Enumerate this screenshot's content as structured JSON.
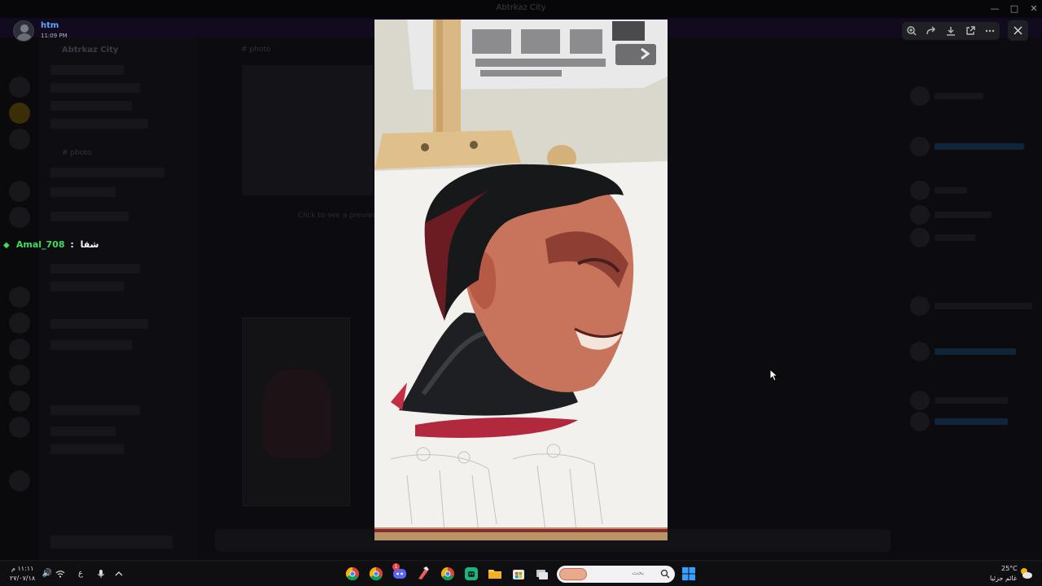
{
  "window": {
    "title": "Abtrkaz City"
  },
  "background_discord": {
    "server_name": "Abtrkaz City",
    "channel_name": "# photo",
    "chat_header": "# photo",
    "hint_text": "Click to see a preview"
  },
  "user_toast": {
    "username": "htm",
    "time": "11:09 PM"
  },
  "overlay_chat": {
    "username": "Amal_708",
    "separator": ":",
    "message": "شقا"
  },
  "viewer_toolbar": {
    "icons": [
      "zoom-in-icon",
      "forward-icon",
      "download-icon",
      "open-external-icon",
      "more-icon"
    ],
    "close_icon": "close-icon"
  },
  "taskbar": {
    "clock_time": "١١:١١ م",
    "clock_date": "٢٧/٠٧/١٨",
    "tray_language": "ع",
    "search_placeholder": "بحث",
    "weather_temp": "25°C",
    "weather_desc": "غائم جزئيا",
    "apps": [
      "chrome-icon",
      "chrome-icon",
      "discord-icon",
      "brush-app-icon",
      "chrome-icon",
      "android-app-icon",
      "file-explorer-icon",
      "store-icon",
      "task-view-icon"
    ],
    "discord_badge": "1"
  },
  "colors": {
    "overlay_green": "#3ddc5b",
    "username_blue": "#5aa9ff",
    "taskbar_bg": "#0f0f11",
    "viewer_button_bg": "#1f2024"
  }
}
